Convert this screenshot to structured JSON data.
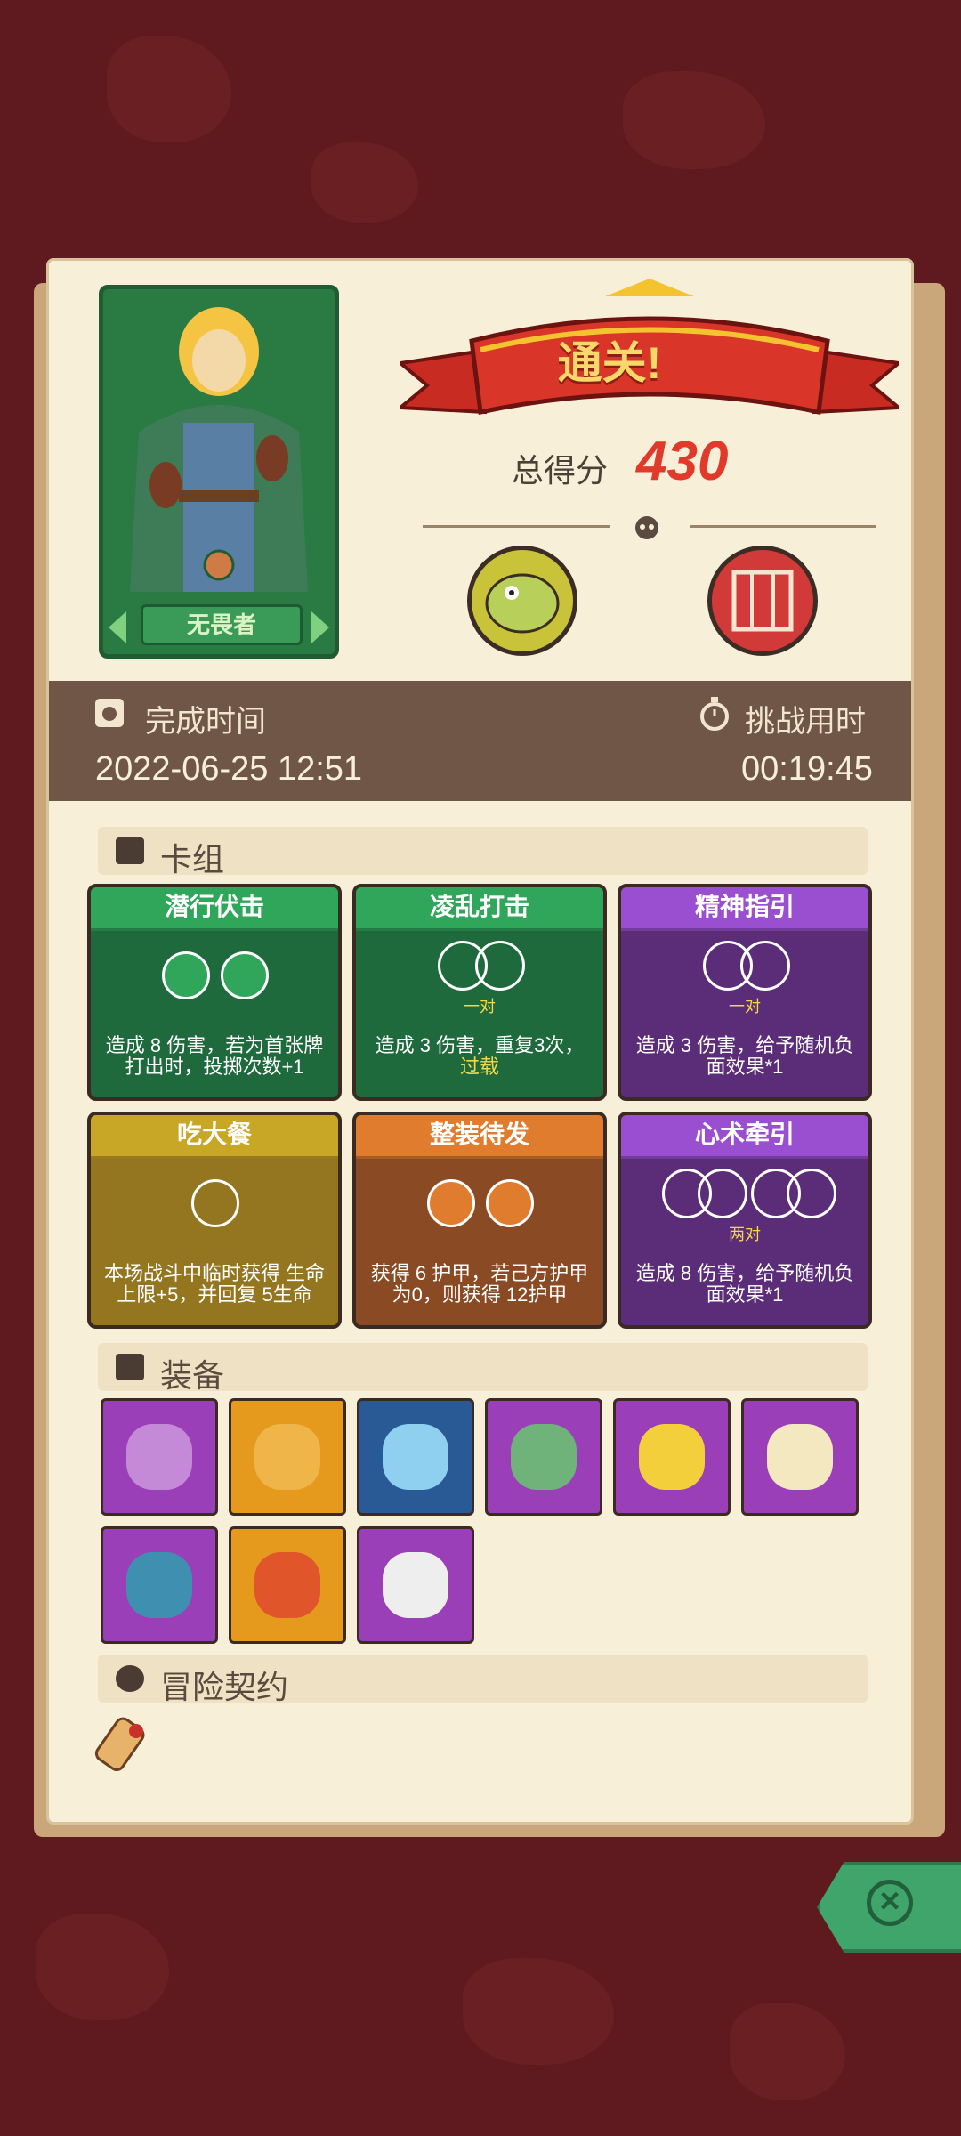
{
  "hero": {
    "name": "无畏者"
  },
  "result": {
    "banner": "通关!",
    "score_label": "总得分",
    "score_value": "430"
  },
  "stats": {
    "finish_time_label": "完成时间",
    "finish_time_value": "2022-06-25 12:51",
    "duration_label": "挑战用时",
    "duration_value": "00:19:45"
  },
  "deck": {
    "title": "卡组",
    "cards": [
      {
        "name": "潜行伏击",
        "desc": "造成 8 伤害，若为首张牌打出时，投掷次数+1",
        "sub": "",
        "color": "#2a8a48"
      },
      {
        "name": "凌乱打击",
        "desc": "造成 3 伤害，重复3次，",
        "desc2": "过载",
        "sub": "一对",
        "color": "#2a8a48"
      },
      {
        "name": "精神指引",
        "desc": "造成 3 伤害，给予随机负面效果*1",
        "sub": "一对",
        "color": "#8a3fb5"
      },
      {
        "name": "吃大餐",
        "desc": "本场战斗中临时获得 生命上限+5，并回复 5生命",
        "sub": "",
        "color": "#b3931e"
      },
      {
        "name": "整装待发",
        "desc": "获得 6 护甲，若己方护甲为0，则获得 12护甲",
        "sub": "",
        "color": "#d8742a"
      },
      {
        "name": "心术牵引",
        "desc": "造成 8 伤害，给予随机负面效果*1",
        "sub": "两对",
        "color": "#8a3fb5"
      }
    ]
  },
  "equipment": {
    "title": "装备",
    "items": [
      {
        "icon": "potion-icon",
        "bg": "#9a3fb8"
      },
      {
        "icon": "cloak-icon",
        "bg": "#e59a1e"
      },
      {
        "icon": "crystal-icon",
        "bg": "#2a5a96"
      },
      {
        "icon": "leaf-ring-icon",
        "bg": "#9a3fb8"
      },
      {
        "icon": "cheese-icon",
        "bg": "#9a3fb8"
      },
      {
        "icon": "mirror-icon",
        "bg": "#9a3fb8"
      },
      {
        "icon": "mask-icon",
        "bg": "#9a3fb8"
      },
      {
        "icon": "crown-icon",
        "bg": "#e59a1e"
      },
      {
        "icon": "cracked-rune-icon",
        "bg": "#9a3fb8"
      }
    ]
  },
  "contract": {
    "title": "冒险契约",
    "icon": "scroll-icon"
  },
  "colors": {
    "score": "#e03a2a",
    "panel": "#f7efd8",
    "band": "#6f5647"
  }
}
